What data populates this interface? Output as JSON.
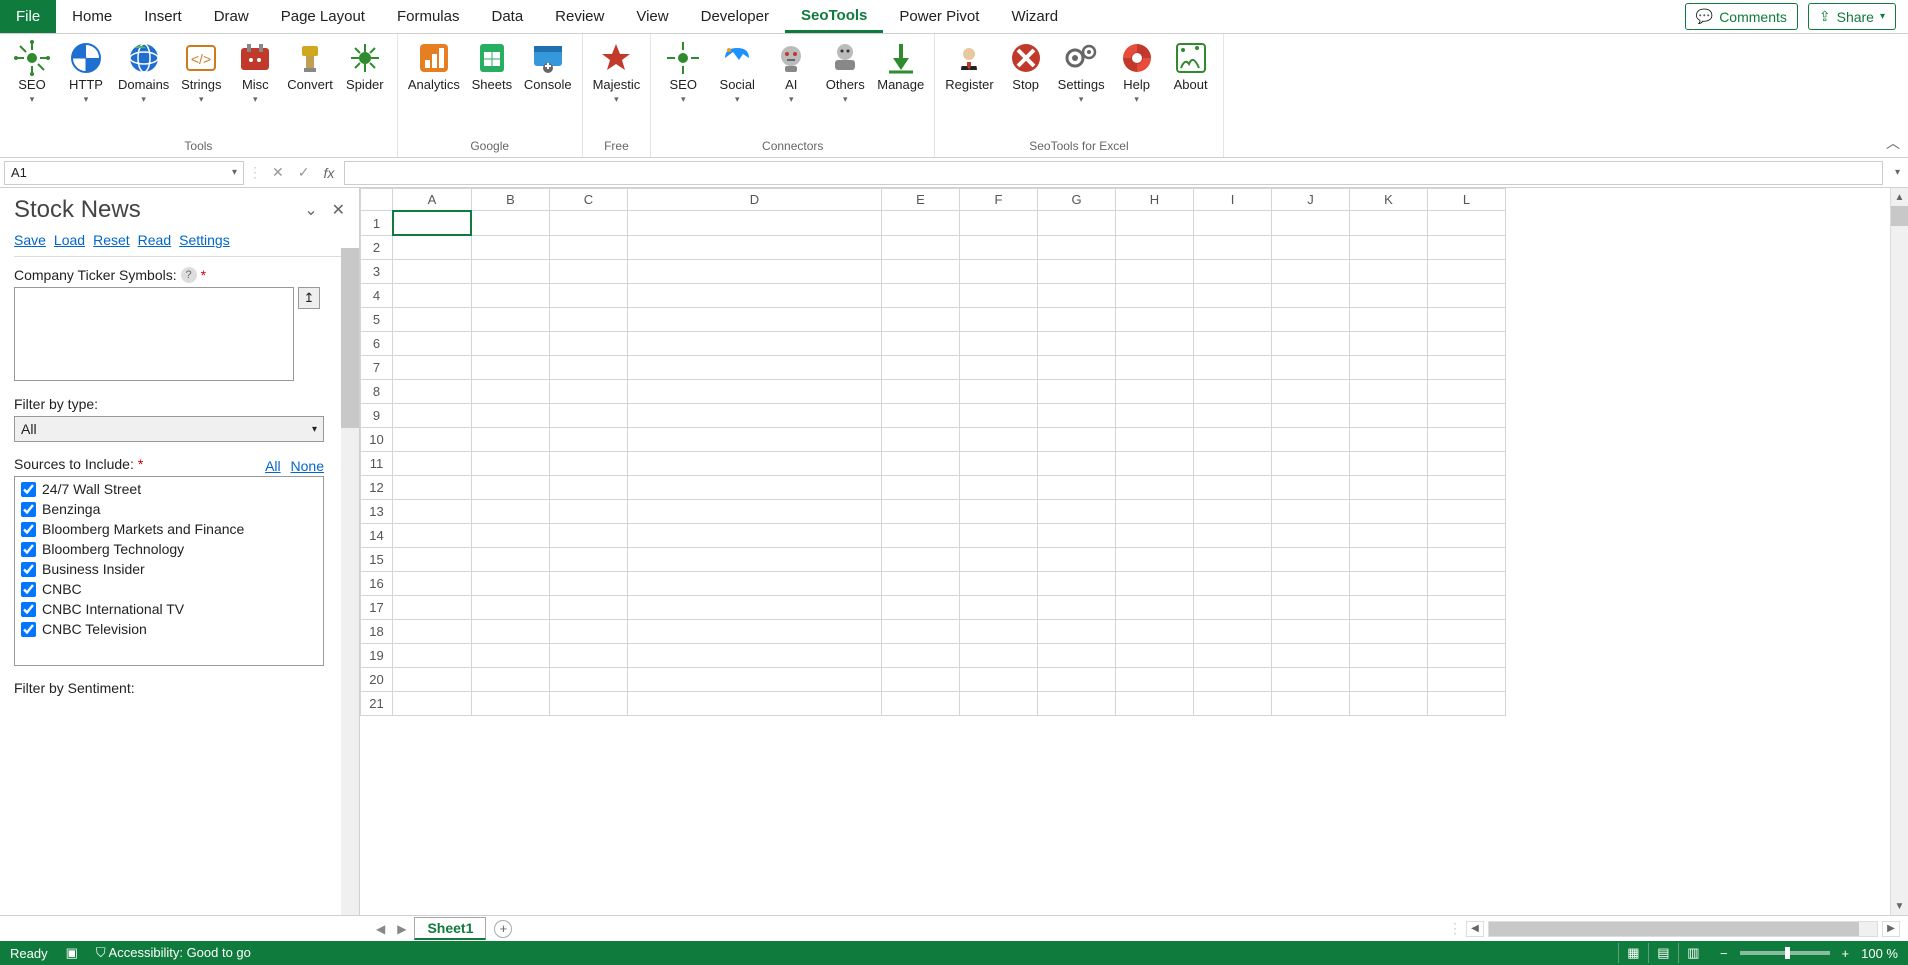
{
  "tabs": {
    "file": "File",
    "items": [
      "Home",
      "Insert",
      "Draw",
      "Page Layout",
      "Formulas",
      "Data",
      "Review",
      "View",
      "Developer",
      "SeoTools",
      "Power Pivot",
      "Wizard"
    ],
    "active": "SeoTools",
    "comments": "Comments",
    "share": "Share"
  },
  "ribbon": {
    "groups": [
      {
        "label": "Tools",
        "items": [
          {
            "name": "seo",
            "label": "SEO",
            "arrow": true,
            "color": "#2e8b2e"
          },
          {
            "name": "http",
            "label": "HTTP",
            "arrow": true,
            "color": "#1e6fd0"
          },
          {
            "name": "domains",
            "label": "Domains",
            "arrow": true,
            "color": "#1e6fd0"
          },
          {
            "name": "strings",
            "label": "Strings",
            "arrow": true,
            "color": "#d07a1e"
          },
          {
            "name": "misc",
            "label": "Misc",
            "arrow": true,
            "color": "#c0392b"
          },
          {
            "name": "convert",
            "label": "Convert",
            "arrow": false,
            "color": "#d0a81e"
          },
          {
            "name": "spider",
            "label": "Spider",
            "arrow": false,
            "color": "#2e8b2e"
          }
        ]
      },
      {
        "label": "Google",
        "items": [
          {
            "name": "analytics",
            "label": "Analytics",
            "arrow": false,
            "color": "#e67e22"
          },
          {
            "name": "sheets",
            "label": "Sheets",
            "arrow": false,
            "color": "#27ae60"
          },
          {
            "name": "console",
            "label": "Console",
            "arrow": false,
            "color": "#3498db"
          }
        ]
      },
      {
        "label": "Free",
        "items": [
          {
            "name": "majestic",
            "label": "Majestic",
            "arrow": true,
            "color": "#c0392b"
          }
        ]
      },
      {
        "label": "Connectors",
        "items": [
          {
            "name": "seo2",
            "label": "SEO",
            "arrow": true,
            "color": "#2e8b2e"
          },
          {
            "name": "social",
            "label": "Social",
            "arrow": true,
            "color": "#1e90ff"
          },
          {
            "name": "ai",
            "label": "AI",
            "arrow": true,
            "color": "#888"
          },
          {
            "name": "others",
            "label": "Others",
            "arrow": true,
            "color": "#888"
          },
          {
            "name": "manage",
            "label": "Manage",
            "arrow": false,
            "color": "#2e8b2e"
          }
        ]
      },
      {
        "label": "SeoTools for Excel",
        "items": [
          {
            "name": "register",
            "label": "Register",
            "arrow": false,
            "color": "#222"
          },
          {
            "name": "stop",
            "label": "Stop",
            "arrow": false,
            "color": "#c0392b"
          },
          {
            "name": "settings",
            "label": "Settings",
            "arrow": true,
            "color": "#666"
          },
          {
            "name": "help",
            "label": "Help",
            "arrow": true,
            "color": "#c0392b"
          },
          {
            "name": "about",
            "label": "About",
            "arrow": false,
            "color": "#2e8b2e"
          }
        ]
      }
    ]
  },
  "namebox": "A1",
  "taskpane": {
    "title": "Stock News",
    "links": [
      "Save",
      "Load",
      "Reset",
      "Read",
      "Settings"
    ],
    "ticker_label": "Company Ticker Symbols:",
    "filter_type_label": "Filter by type:",
    "filter_type_value": "All",
    "sources_label": "Sources to Include:",
    "sources_all": "All",
    "sources_none": "None",
    "sources": [
      "24/7 Wall Street",
      "Benzinga",
      "Bloomberg Markets and Finance",
      "Bloomberg Technology",
      "Business Insider",
      "CNBC",
      "CNBC International TV",
      "CNBC Television"
    ],
    "sentiment_label": "Filter by Sentiment:"
  },
  "columns": [
    "A",
    "B",
    "C",
    "D",
    "E",
    "F",
    "G",
    "H",
    "I",
    "J",
    "K",
    "L"
  ],
  "rows": [
    1,
    2,
    3,
    4,
    5,
    6,
    7,
    8,
    9,
    10,
    11,
    12,
    13,
    14,
    15,
    16,
    17,
    18,
    19,
    20,
    21
  ],
  "sheetbar": {
    "tab": "Sheet1"
  },
  "status": {
    "ready": "Ready",
    "accessibility": "Accessibility: Good to go",
    "zoom": "100 %"
  }
}
